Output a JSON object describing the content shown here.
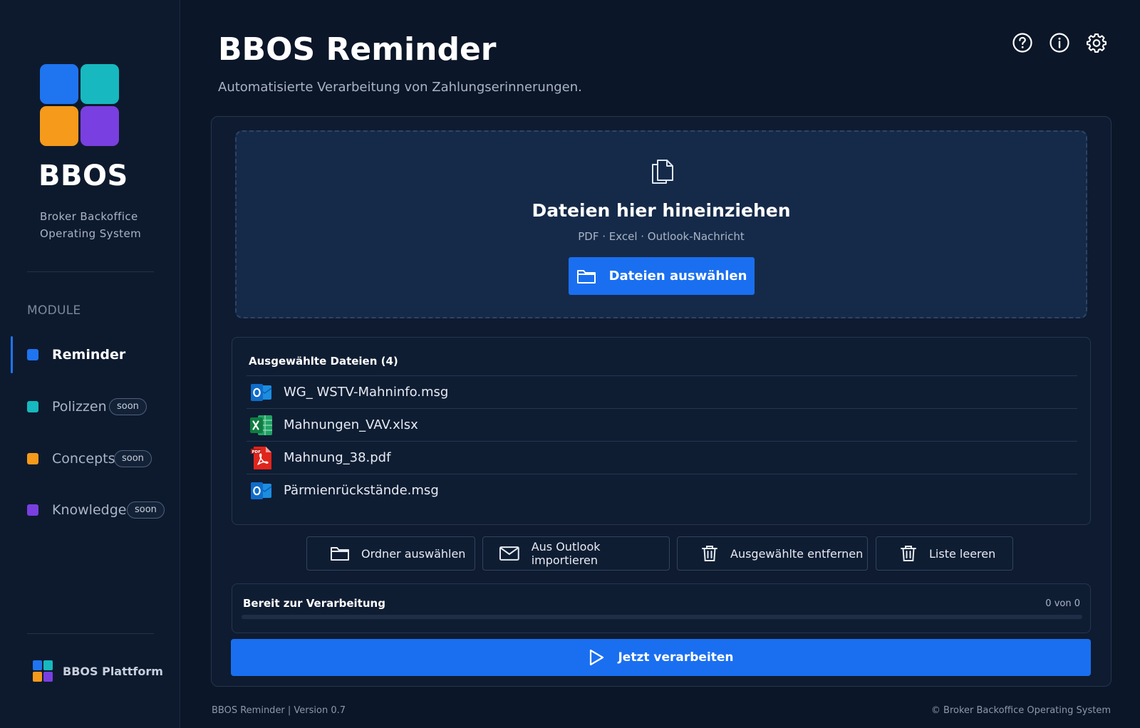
{
  "colors": {
    "background": "#0b1628",
    "sidebar": "#0d1a2e",
    "accent": "#1a6ff0",
    "logo": [
      "#1f74f0",
      "#17b8bf",
      "#f59a1a",
      "#7a3fe0"
    ]
  },
  "sidebar": {
    "brand": "BBOS",
    "brand_subtitle": "Broker Backoffice Operating System",
    "modules_heading": "MODULE",
    "items": [
      {
        "label": "Reminder",
        "color": "#1f74f0",
        "active": true,
        "badge": ""
      },
      {
        "label": "Polizzen",
        "color": "#17b8bf",
        "active": false,
        "badge": "soon"
      },
      {
        "label": "Concepts",
        "color": "#f59a1a",
        "active": false,
        "badge": "soon"
      },
      {
        "label": "Knowledge",
        "color": "#7a3fe0",
        "active": false,
        "badge": "soon"
      }
    ],
    "platform_label": "BBOS Plattform"
  },
  "header": {
    "title": "BBOS Reminder",
    "subtitle": "Automatisierte Verarbeitung von Zahlungserinnerungen.",
    "icons": [
      "help-icon",
      "info-icon",
      "gear-icon"
    ]
  },
  "dropzone": {
    "icon": "copy-files-icon",
    "title": "Dateien hier hineinziehen",
    "subtitle": "PDF · Excel · Outlook-Nachricht",
    "button_label": "Dateien auswählen",
    "button_icon": "folder-icon"
  },
  "file_list": {
    "title": "Ausgewählte Dateien (4)",
    "files": [
      {
        "name": "WG_ WSTV-Mahninfo.msg",
        "type": "outlook-icon"
      },
      {
        "name": "Mahnungen_VAV.xlsx",
        "type": "excel-icon"
      },
      {
        "name": "Mahnung_38.pdf",
        "type": "pdf-icon"
      },
      {
        "name": "Pärmienrückstände.msg",
        "type": "outlook-icon"
      }
    ]
  },
  "actions": {
    "select_folder": "Ordner auswählen",
    "import_outlook": "Aus Outlook importieren",
    "remove_selected": "Ausgewählte entfernen",
    "clear_list": "Liste leeren"
  },
  "status": {
    "label": "Bereit zur Verarbeitung",
    "count": "0 von 0",
    "progress": 0
  },
  "run_button": {
    "label": "Jetzt verarbeiten",
    "icon": "play-icon"
  },
  "footer": {
    "version": "BBOS Reminder | Version 0.7",
    "copyright": "© Broker Backoffice Operating System"
  }
}
